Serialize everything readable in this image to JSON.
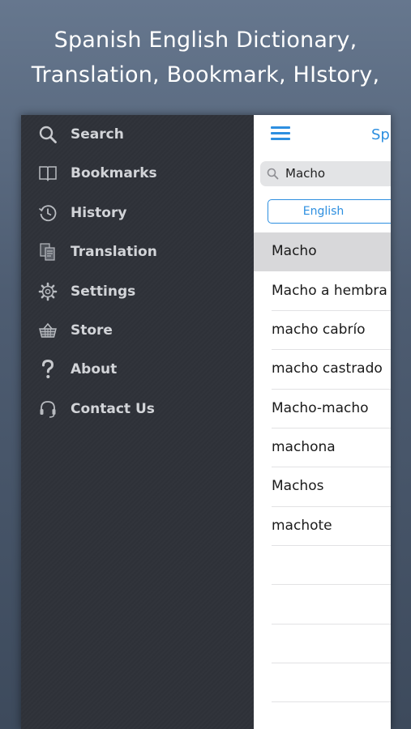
{
  "headline": {
    "line1": "Spanish English Dictionary,",
    "line2": "Translation, Bookmark, HIstory,"
  },
  "sidebar": {
    "items": [
      {
        "label": "Search",
        "icon": "search-icon"
      },
      {
        "label": "Bookmarks",
        "icon": "book-icon"
      },
      {
        "label": "History",
        "icon": "history-clock-icon"
      },
      {
        "label": "Translation",
        "icon": "translation-pages-icon"
      },
      {
        "label": "Settings",
        "icon": "gear-icon"
      },
      {
        "label": "Store",
        "icon": "basket-icon"
      },
      {
        "label": "About",
        "icon": "question-mark-icon"
      },
      {
        "label": "Contact Us",
        "icon": "headset-icon"
      }
    ]
  },
  "panel": {
    "title": "Sp",
    "search": {
      "value": "Macho"
    },
    "language_button": "English",
    "results": [
      "Macho",
      "Macho a hembra",
      "macho cabrío",
      "macho castrado",
      "Macho-macho",
      "machona",
      "Machos",
      "machote"
    ],
    "selected_index": 0
  },
  "colors": {
    "accent": "#2d8fe0",
    "sidebar_bg": "#2f3239",
    "sidebar_text": "#d2d4d8",
    "selected_row": "#d8d8da"
  }
}
